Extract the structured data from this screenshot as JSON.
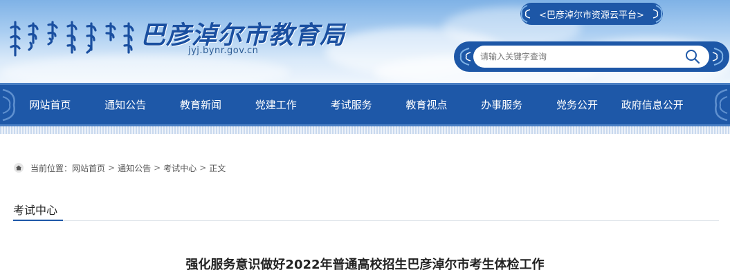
{
  "header": {
    "site_title": "巴彦淖尔市教育局",
    "site_domain": "jyj.bynr.gov.cn",
    "logo_icon": "mongolian-script-logo",
    "platform_link": "<巴彦淖尔市资源云平台>",
    "search": {
      "placeholder": "请输入关键字查询",
      "value": "",
      "icon": "search-icon"
    }
  },
  "nav": {
    "items": [
      {
        "label": "网站首页"
      },
      {
        "label": "通知公告"
      },
      {
        "label": "教育新闻"
      },
      {
        "label": "党建工作"
      },
      {
        "label": "考试服务"
      },
      {
        "label": "教育视点"
      },
      {
        "label": "办事服务"
      },
      {
        "label": "党务公开"
      },
      {
        "label": "政府信息公开"
      }
    ]
  },
  "breadcrumb": {
    "icon": "home-icon",
    "prefix": "当前位置：",
    "items": [
      {
        "label": "网站首页"
      },
      {
        "label": "通知公告"
      },
      {
        "label": "考试中心"
      },
      {
        "label": "正文"
      }
    ],
    "separator": ">"
  },
  "section": {
    "title": "考试中心"
  },
  "article": {
    "title": "强化服务意识做好2022年普通高校招生巴彦淖尔市考生体检工作"
  },
  "colors": {
    "brand_blue": "#1e58a8",
    "title_blue": "#1a4fa0",
    "text": "#222222"
  }
}
